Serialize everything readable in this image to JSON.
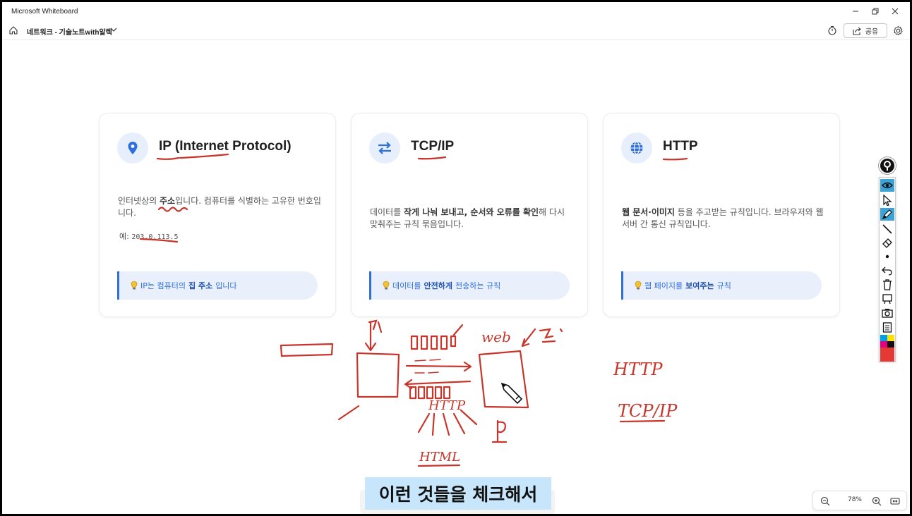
{
  "window": {
    "app_title": "Microsoft Whiteboard"
  },
  "toolbar": {
    "board_title": "네트워크 - 기술노트with알렉",
    "share_label": "공유"
  },
  "cards": [
    {
      "title": "IP (Internet Protocol)",
      "desc_pre": "인터넷상의 ",
      "desc_bold": "주소",
      "desc_post": "입니다. 컴퓨터를 식별하는 고유한 번호입니다.",
      "example_label": "예: ",
      "example_value": "203.0.113.5",
      "tip_pre": "IP는 컴퓨터의 ",
      "tip_bold": "집 주소",
      "tip_post": "입니다",
      "icon": "location-pin-icon"
    },
    {
      "title": "TCP/IP",
      "desc_pre": "데이터를 ",
      "desc_bold": "작게 나눠 보내고, 순서와 오류를 확인",
      "desc_post": "해 다시 맞춰주는 규칙 묶음입니다.",
      "tip_pre": "데이터를 ",
      "tip_bold": "안전하게",
      "tip_post": " 전송하는 규칙",
      "icon": "swap-arrows-icon"
    },
    {
      "title": "HTTP",
      "desc_pre": "",
      "desc_bold": "웹 문서·이미지",
      "desc_post": " 등을 주고받는 규칙입니다. 브라우저와 웹서버 간 통신 규칙입니다.",
      "tip_pre": "웹 페이지를 ",
      "tip_bold": "보여주는",
      "tip_post": " 규칙",
      "icon": "globe-icon"
    }
  ],
  "ink": {
    "labels": [
      "web",
      "HTTP",
      "HTML",
      "HTTP",
      "TCP/IP"
    ]
  },
  "zoom": {
    "level": "78%"
  },
  "caption": {
    "text": "이런 것들을 체크해서"
  },
  "colors": {
    "accent": "#2f6fdd",
    "ink": "#c8352b",
    "caption_bg": "#c7e6fb"
  }
}
